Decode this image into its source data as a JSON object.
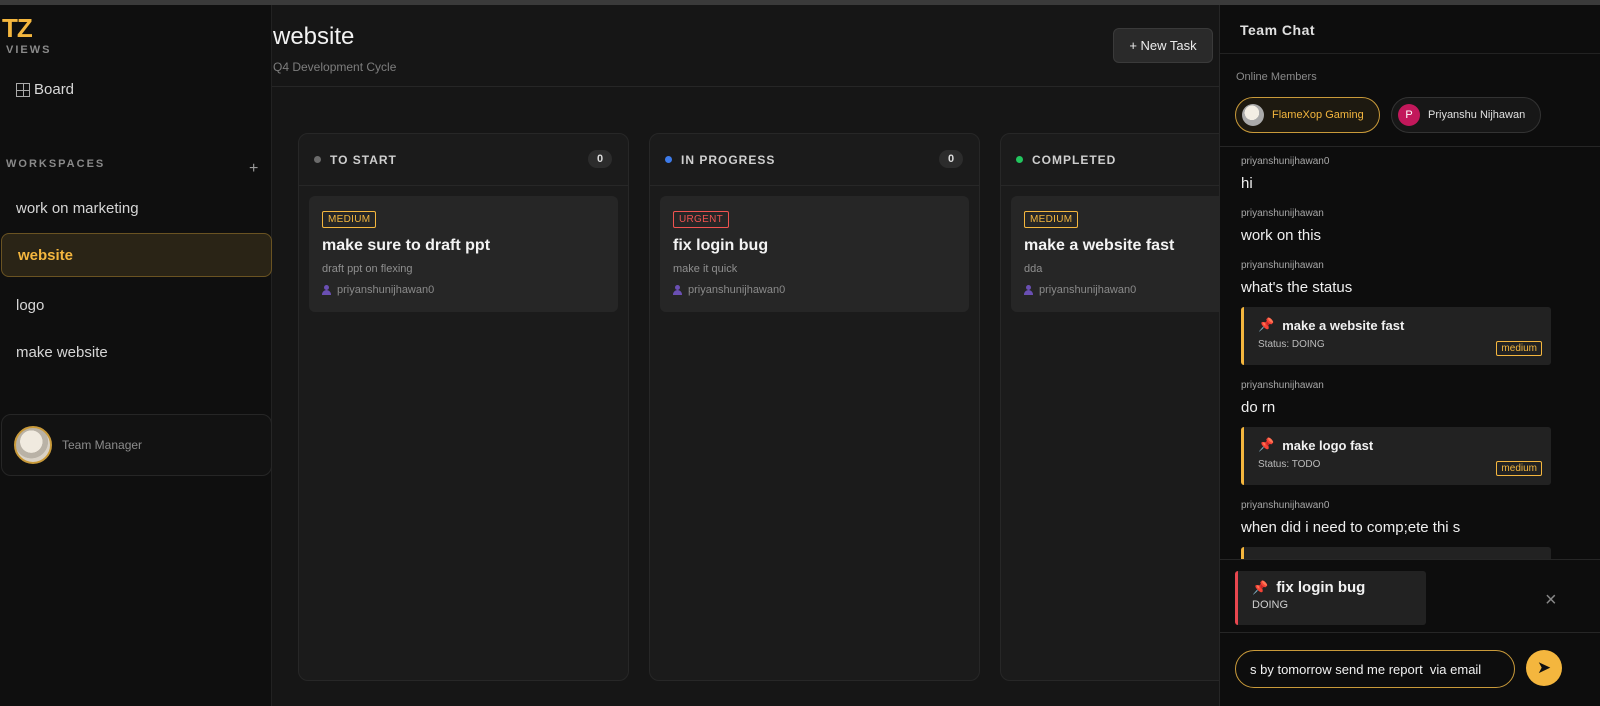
{
  "app": {
    "logo": "TZ"
  },
  "sidebar": {
    "views_label": "VIEWS",
    "board_label": "Board",
    "workspaces_label": "WORKSPACES",
    "add_label": "+",
    "workspaces": [
      {
        "label": "work on marketing",
        "active": false
      },
      {
        "label": "website",
        "active": true
      },
      {
        "label": "logo",
        "active": false
      },
      {
        "label": "make website",
        "active": false
      }
    ],
    "manager_label": "Team Manager"
  },
  "header": {
    "title": "website",
    "subtitle": "Q4 Development Cycle",
    "new_task_label": "+ New Task"
  },
  "board": {
    "columns": [
      {
        "title": "TO START",
        "count": "0",
        "dot_color": "#6b6b6b",
        "card": {
          "priority": "MEDIUM",
          "priority_kind": "medium",
          "title": "make sure to draft ppt",
          "description": "draft ppt on flexing",
          "assignee": "priyanshunijhawan0"
        }
      },
      {
        "title": "IN PROGRESS",
        "count": "0",
        "dot_color": "#3d7bea",
        "card": {
          "priority": "URGENT",
          "priority_kind": "urgent",
          "title": "fix login bug",
          "description": "make it quick",
          "assignee": "priyanshunijhawan0"
        }
      },
      {
        "title": "COMPLETED",
        "count": "",
        "dot_color": "#22c55e",
        "card": {
          "priority": "MEDIUM",
          "priority_kind": "medium",
          "title": "make a website fast",
          "description": "dda",
          "assignee": "priyanshunijhawan0"
        }
      }
    ]
  },
  "chat": {
    "title": "Team Chat",
    "online_label": "Online Members",
    "members": [
      {
        "name": "FlameXop Gaming"
      },
      {
        "name": "Priyanshu Nijhawan",
        "initial": "P"
      }
    ],
    "messages": [
      {
        "user": "priyanshunijhawan0",
        "text": "hi"
      },
      {
        "user": "priyanshunijhawan",
        "text": "work on this"
      },
      {
        "user": "priyanshunijhawan",
        "text": "what's the status"
      },
      {
        "task_title": "make a website fast",
        "task_status": "Status: DOING",
        "task_badge": "medium"
      },
      {
        "user": "priyanshunijhawan",
        "text": "do rn"
      },
      {
        "task_title": "make logo fast",
        "task_status": "Status: TODO",
        "task_badge": "medium"
      },
      {
        "user": "priyanshunijhawan0",
        "text": "when did i need to comp;ete thi s"
      }
    ],
    "reply": {
      "title": "fix login bug",
      "status": "DOING",
      "close": "×"
    },
    "input_value": "s by tomorrow send me report  via email",
    "send_icon": "send-icon"
  }
}
